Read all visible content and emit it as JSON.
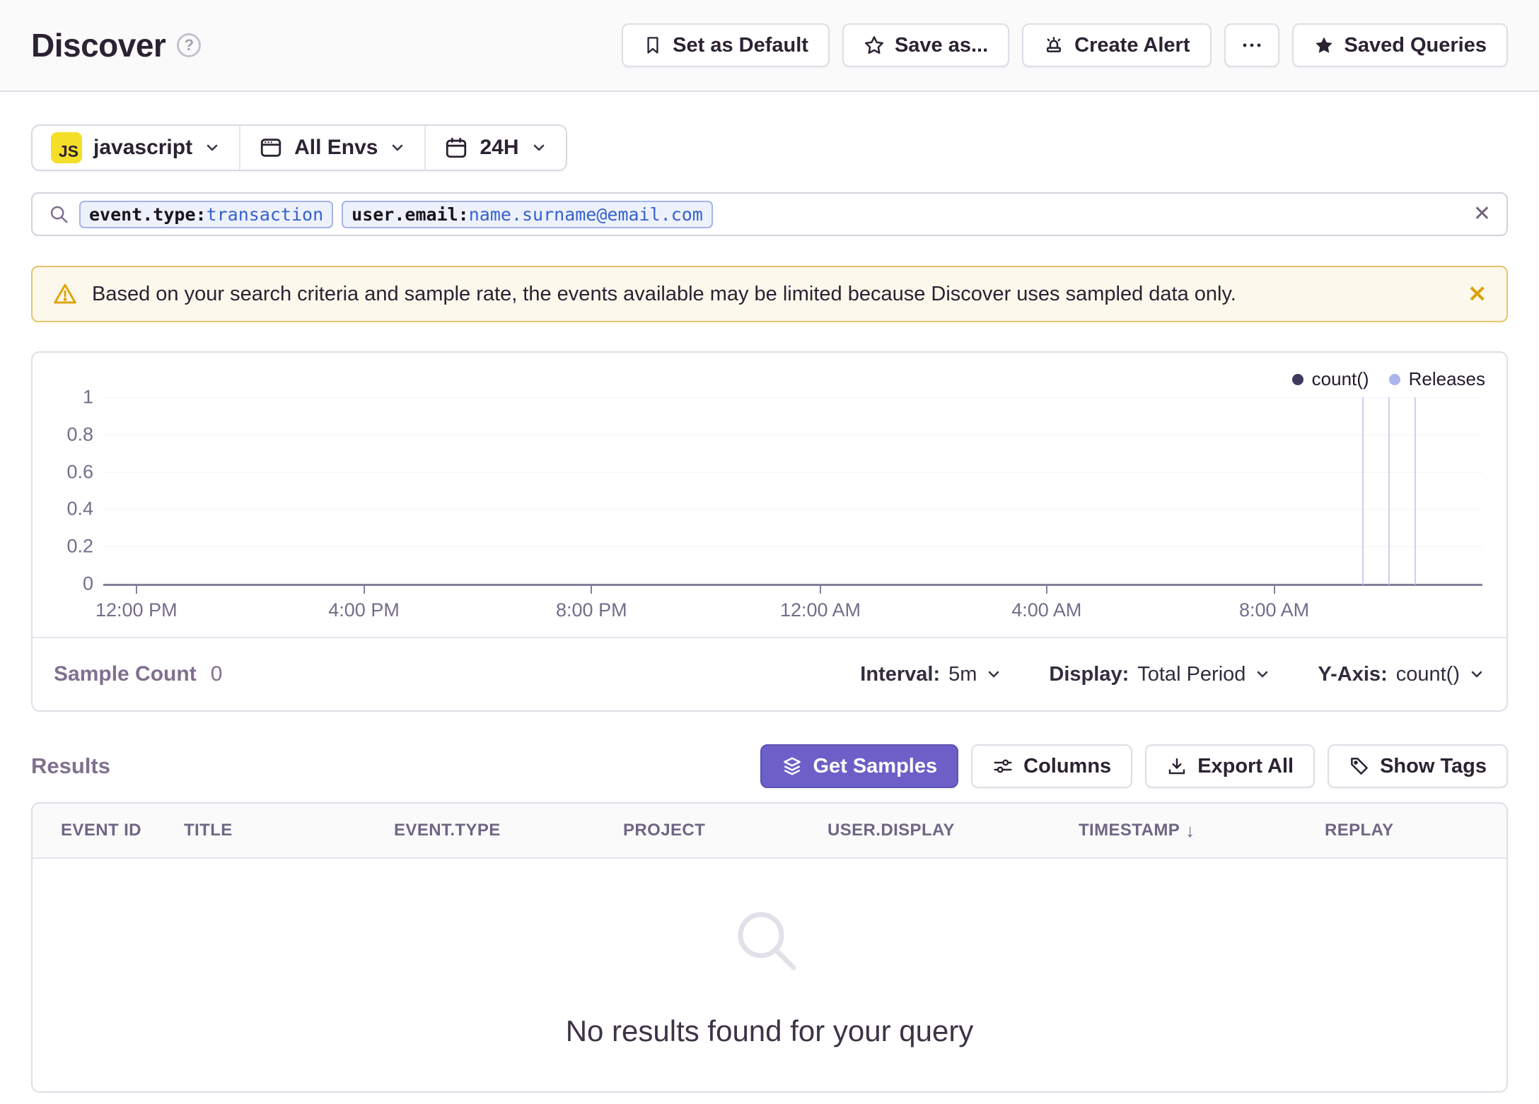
{
  "header": {
    "title": "Discover",
    "help": "?",
    "actions": {
      "set_as_default": "Set as Default",
      "save_as": "Save as...",
      "create_alert": "Create Alert",
      "saved_queries": "Saved Queries"
    }
  },
  "filters": {
    "project": {
      "badge": "JS",
      "label": "javascript"
    },
    "environment": {
      "label": "All Envs"
    },
    "time_range": {
      "label": "24H"
    }
  },
  "search": {
    "tokens": [
      {
        "key": "event.type:",
        "value": "transaction"
      },
      {
        "key": "user.email:",
        "value": "name.surname@email.com"
      }
    ],
    "clear_icon": "✕"
  },
  "warning": {
    "message": "Based on your search criteria and sample rate, the events available may be limited because Discover uses sampled data only.",
    "close_icon": "✕"
  },
  "chart_data": {
    "type": "line",
    "title": "",
    "series": [
      {
        "name": "count()",
        "values": [
          0,
          0,
          0,
          0,
          0,
          0
        ]
      }
    ],
    "legend": [
      {
        "label": "count()",
        "color": "#3e3a5d"
      },
      {
        "label": "Releases",
        "color": "#acb4ee"
      }
    ],
    "y_axis": {
      "ticks": [
        "1",
        "0.8",
        "0.6",
        "0.4",
        "0.2",
        "0"
      ],
      "range": [
        0,
        1
      ]
    },
    "x_axis": {
      "ticks": [
        "12:00 PM",
        "4:00 PM",
        "8:00 PM",
        "12:00 AM",
        "4:00 AM",
        "8:00 AM"
      ],
      "positions_pct": [
        2.4,
        18.9,
        35.4,
        52.0,
        68.4,
        84.9
      ]
    },
    "releases": {
      "positions_pct": [
        91.3,
        93.2,
        95.1
      ]
    },
    "grid": true,
    "legend_position": "top-right"
  },
  "chart_footer": {
    "sample_count_label": "Sample Count",
    "sample_count_value": "0",
    "interval": {
      "label": "Interval:",
      "value": "5m"
    },
    "display": {
      "label": "Display:",
      "value": "Total Period"
    },
    "y_axis": {
      "label": "Y-Axis:",
      "value": "count()"
    }
  },
  "results": {
    "title": "Results",
    "buttons": {
      "get_samples": "Get Samples",
      "columns": "Columns",
      "export_all": "Export All",
      "show_tags": "Show Tags"
    },
    "table": {
      "headers": [
        "EVENT ID",
        "TITLE",
        "EVENT.TYPE",
        "PROJECT",
        "USER.DISPLAY",
        "TIMESTAMP",
        "REPLAY"
      ],
      "sort_column": "TIMESTAMP",
      "sort_icon": "↓",
      "rows": []
    },
    "empty_message": "No results found for your query"
  },
  "colors": {
    "accent_purple": "#6c5fc7",
    "warning_amber": "#d9a210",
    "warning_bg": "#fdf8ec",
    "token_blue": "#3661ce",
    "token_bg": "#edf1fc",
    "js_yellow": "#f5de27",
    "axis": "#867e9c",
    "release_line": "#cbcff2",
    "muted_text": "#80708f"
  }
}
